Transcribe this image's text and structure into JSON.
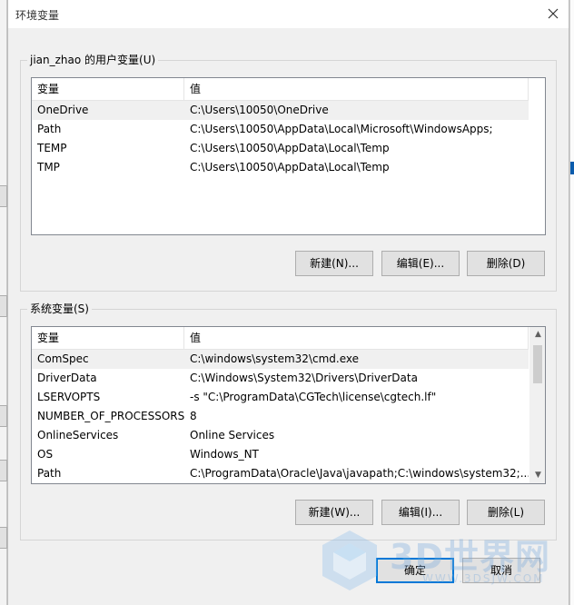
{
  "dialog": {
    "title": "环境变量",
    "close_label": "×"
  },
  "user_vars": {
    "legend": "jian_zhao 的用户变量(U)",
    "columns": [
      "变量",
      "值"
    ],
    "rows": [
      {
        "name": "OneDrive",
        "value": "C:\\Users\\10050\\OneDrive",
        "selected": true
      },
      {
        "name": "Path",
        "value": "C:\\Users\\10050\\AppData\\Local\\Microsoft\\WindowsApps;"
      },
      {
        "name": "TEMP",
        "value": "C:\\Users\\10050\\AppData\\Local\\Temp"
      },
      {
        "name": "TMP",
        "value": "C:\\Users\\10050\\AppData\\Local\\Temp"
      }
    ],
    "buttons": {
      "new": "新建(N)...",
      "edit": "编辑(E)...",
      "delete": "删除(D)"
    }
  },
  "system_vars": {
    "legend": "系统变量(S)",
    "columns": [
      "变量",
      "值"
    ],
    "rows": [
      {
        "name": "ComSpec",
        "value": "C:\\windows\\system32\\cmd.exe",
        "selected": true
      },
      {
        "name": "DriverData",
        "value": "C:\\Windows\\System32\\Drivers\\DriverData"
      },
      {
        "name": "LSERVOPTS",
        "value": "-s \"C:\\ProgramData\\CGTech\\license\\cgtech.lf\""
      },
      {
        "name": "NUMBER_OF_PROCESSORS",
        "value": "8"
      },
      {
        "name": "OnlineServices",
        "value": "Online Services"
      },
      {
        "name": "OS",
        "value": "Windows_NT"
      },
      {
        "name": "Path",
        "value": "C:\\ProgramData\\Oracle\\Java\\javapath;C:\\windows\\system32;..."
      }
    ],
    "buttons": {
      "new": "新建(W)...",
      "edit": "编辑(I)...",
      "delete": "删除(L)"
    }
  },
  "footer": {
    "ok": "确定",
    "cancel": "取消"
  },
  "watermark": {
    "text": "3D世界网",
    "sub": "WWW.3DSJW.COM"
  },
  "colors": {
    "selection": "#f0f0f0",
    "default_button_border": "#0078d7",
    "window_bg": "#f0f0f0"
  }
}
